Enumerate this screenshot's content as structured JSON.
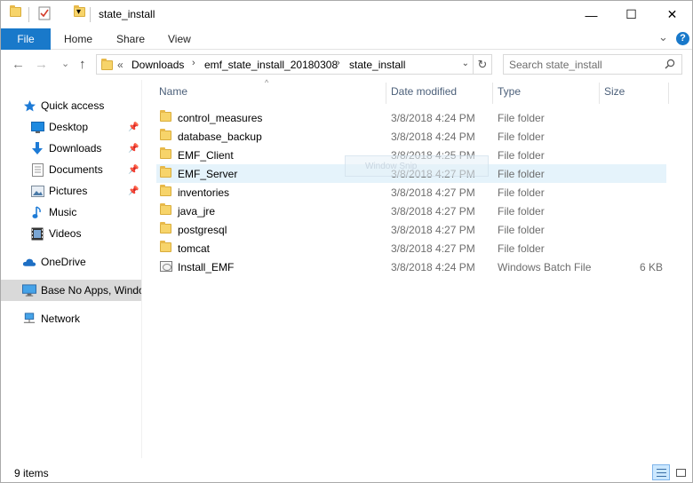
{
  "window": {
    "title": "state_install",
    "minimize": "—",
    "maximize": "☐",
    "close": "✕"
  },
  "ribbon": {
    "tabs": [
      "File",
      "Home",
      "Share",
      "View"
    ],
    "expand": "⌄",
    "help": "?"
  },
  "nav": {
    "back": "←",
    "forward": "→",
    "recent": "⌄",
    "up": "↑",
    "breadcrumbs": [
      "Downloads",
      "emf_state_install_20180308",
      "state_install"
    ],
    "overflow": "«",
    "separator": "›",
    "dropdown": "⌄",
    "refresh": "↻",
    "search_placeholder": "Search state_install"
  },
  "sidebar": {
    "items": [
      {
        "label": "Quick access",
        "icon": "star-icon",
        "pinned": false
      },
      {
        "label": "Desktop",
        "icon": "desktop-icon",
        "pinned": true
      },
      {
        "label": "Downloads",
        "icon": "download-icon",
        "pinned": true
      },
      {
        "label": "Documents",
        "icon": "documents-icon",
        "pinned": true
      },
      {
        "label": "Pictures",
        "icon": "pictures-icon",
        "pinned": true
      },
      {
        "label": "Music",
        "icon": "music-icon",
        "pinned": false
      },
      {
        "label": "Videos",
        "icon": "videos-icon",
        "pinned": false
      },
      {
        "label": "OneDrive",
        "icon": "cloud-icon",
        "pinned": false
      },
      {
        "label": "Base No Apps, Windo",
        "icon": "computer-icon",
        "pinned": false,
        "selected": true
      },
      {
        "label": "Network",
        "icon": "network-icon",
        "pinned": false
      }
    ],
    "pin_glyph": "📌"
  },
  "list": {
    "columns": [
      "Name",
      "Date modified",
      "Type",
      "Size"
    ],
    "sort_indicator": "^",
    "rows": [
      {
        "name": "control_measures",
        "date": "3/8/2018 4:24 PM",
        "type": "File folder",
        "size": "",
        "kind": "folder"
      },
      {
        "name": "database_backup",
        "date": "3/8/2018 4:24 PM",
        "type": "File folder",
        "size": "",
        "kind": "folder"
      },
      {
        "name": "EMF_Client",
        "date": "3/8/2018 4:25 PM",
        "type": "File folder",
        "size": "",
        "kind": "folder"
      },
      {
        "name": "EMF_Server",
        "date": "3/8/2018 4:27 PM",
        "type": "File folder",
        "size": "",
        "kind": "folder",
        "hover": true
      },
      {
        "name": "inventories",
        "date": "3/8/2018 4:27 PM",
        "type": "File folder",
        "size": "",
        "kind": "folder"
      },
      {
        "name": "java_jre",
        "date": "3/8/2018 4:27 PM",
        "type": "File folder",
        "size": "",
        "kind": "folder"
      },
      {
        "name": "postgresql",
        "date": "3/8/2018 4:27 PM",
        "type": "File folder",
        "size": "",
        "kind": "folder"
      },
      {
        "name": "tomcat",
        "date": "3/8/2018 4:27 PM",
        "type": "File folder",
        "size": "",
        "kind": "folder"
      },
      {
        "name": "Install_EMF",
        "date": "3/8/2018 4:24 PM",
        "type": "Windows Batch File",
        "size": "6 KB",
        "kind": "batch"
      }
    ],
    "drag_ghost_label": "Window Snip"
  },
  "status": {
    "item_count": "9 items"
  },
  "colors": {
    "accent": "#1979ca",
    "folder": "#f7d46a",
    "row_hover": "#e5f3fb",
    "sidebar_selected": "#d9d9d9"
  }
}
